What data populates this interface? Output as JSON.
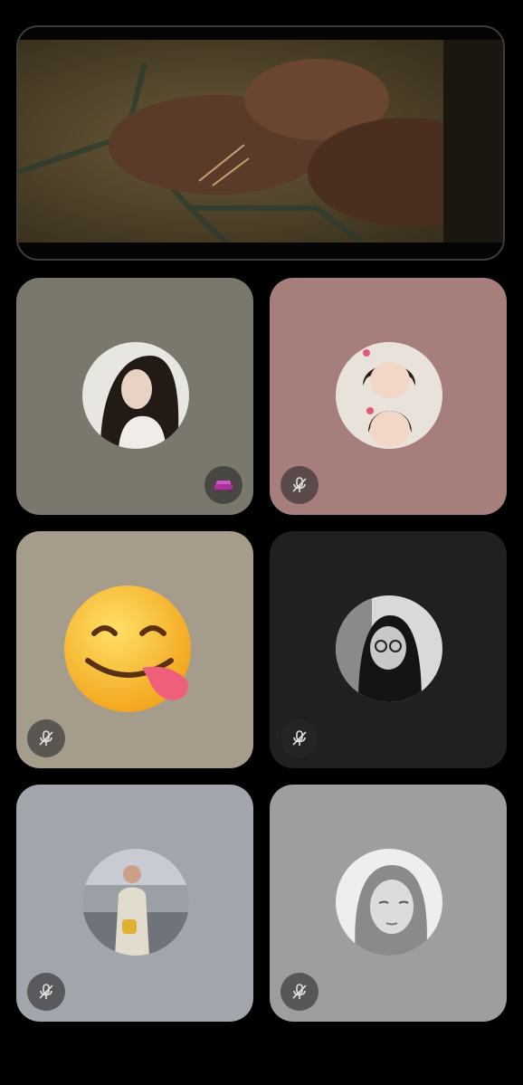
{
  "video": {
    "description_icon": "video-feed"
  },
  "participants": [
    {
      "bg": "#7a776c",
      "avatar": "girl-long-hair-photo",
      "indicator": "sofa-emoji-badge"
    },
    {
      "bg": "#a67e7b",
      "avatar": "girl-bow-photo",
      "indicator": "mic-off-icon"
    },
    {
      "bg": "#a69c8c",
      "avatar": "yum-face-emoji",
      "indicator": "mic-off-icon"
    },
    {
      "bg": "#202020",
      "avatar": "hijab-woman-photo",
      "indicator": "mic-off-icon"
    },
    {
      "bg": "#a1a6ad",
      "avatar": "man-balcony-photo",
      "indicator": "mic-off-icon"
    },
    {
      "bg": "#9e9e9e",
      "avatar": "sketch-girl-photo",
      "indicator": "mic-off-icon"
    }
  ]
}
